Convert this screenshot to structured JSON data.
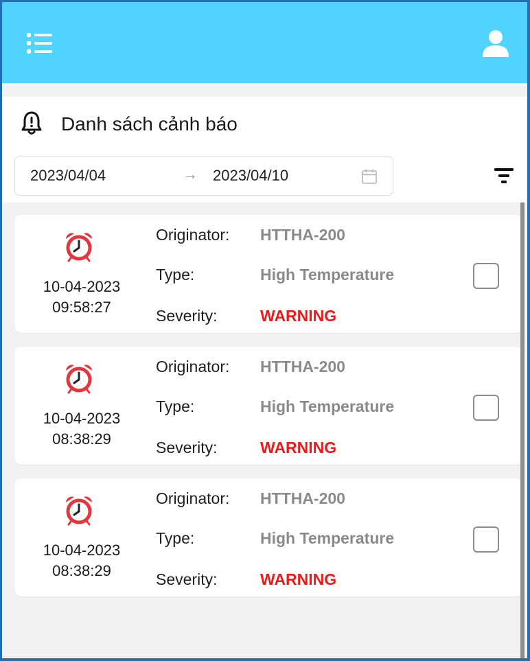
{
  "header": {
    "menu_icon": "list-menu-icon",
    "user_icon": "user-icon",
    "background_color": "#50d3fc"
  },
  "page": {
    "title": "Danh sách cảnh báo",
    "title_icon": "bell-alert-icon"
  },
  "filter": {
    "date_from": "2023/04/04",
    "arrow": "→",
    "date_to": "2023/04/10",
    "calendar_icon": "calendar-icon",
    "filter_icon": "filter-icon"
  },
  "labels": {
    "originator": "Originator:",
    "type": "Type:",
    "severity": "Severity:"
  },
  "alarms": [
    {
      "date": "10-04-2023",
      "time": "09:58:27",
      "originator": "HTTHA-200",
      "type": "High Temperature",
      "severity": "WARNING",
      "checked": false
    },
    {
      "date": "10-04-2023",
      "time": "08:38:29",
      "originator": "HTTHA-200",
      "type": "High Temperature",
      "severity": "WARNING",
      "checked": false
    },
    {
      "date": "10-04-2023",
      "time": "08:38:29",
      "originator": "HTTHA-200",
      "type": "High Temperature",
      "severity": "WARNING",
      "checked": false
    }
  ],
  "colors": {
    "severity_warning": "#f01818",
    "alarm_icon": "#e0383e",
    "value_text": "#8a8a8a"
  }
}
